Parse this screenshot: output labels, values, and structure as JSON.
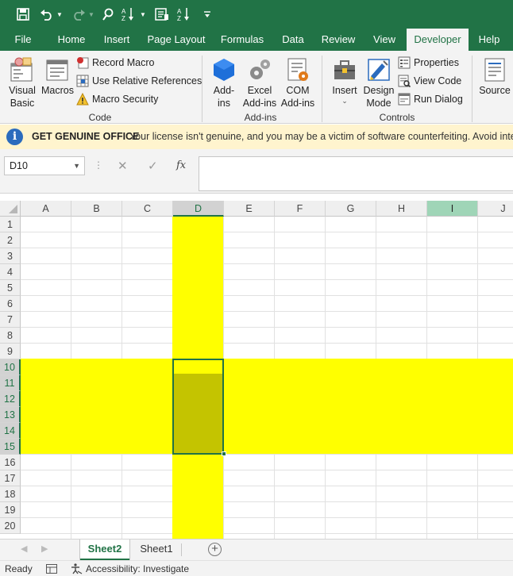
{
  "colors": {
    "excel_green": "#217346",
    "highlight_yellow": "#ffff00",
    "selection_fill": "#c4c400",
    "message_bg": "#fff4ce"
  },
  "quick_access": [
    "save-icon",
    "undo-icon",
    "redo-icon",
    "find-icon",
    "sort-ascending-icon",
    "form-icon",
    "sort-descending-icon",
    "customize-icon"
  ],
  "ribbon_tabs": [
    "File",
    "Home",
    "Insert",
    "Page Layout",
    "Formulas",
    "Data",
    "Review",
    "View",
    "Developer",
    "Help"
  ],
  "active_tab": "Developer",
  "ribbon": {
    "code_group": {
      "label": "Code",
      "visual_basic": [
        "Visual",
        "Basic"
      ],
      "macros": "Macros",
      "record_macro": "Record Macro",
      "relative_refs": "Use Relative References",
      "macro_security": "Macro Security"
    },
    "addins_group": {
      "label": "Add-ins",
      "addins": [
        "Add-",
        "ins"
      ],
      "excel_addins": [
        "Excel",
        "Add-ins"
      ],
      "com_addins": [
        "COM",
        "Add-ins"
      ]
    },
    "controls_group": {
      "label": "Controls",
      "insert": "Insert",
      "design_mode": [
        "Design",
        "Mode"
      ],
      "properties": "Properties",
      "view_code": "View Code",
      "run_dialog": "Run Dialog"
    },
    "xml_group": {
      "source": "Source"
    }
  },
  "message_bar": {
    "title": "GET GENUINE OFFICE",
    "text": "Your license isn't genuine, and you may be a victim of software counterfeiting. Avoid interru"
  },
  "formula_bar": {
    "name_box": "D10",
    "fx": "fx",
    "value": ""
  },
  "columns": [
    "A",
    "B",
    "C",
    "D",
    "E",
    "F",
    "G",
    "H",
    "I",
    "J"
  ],
  "rows": [
    "1",
    "2",
    "3",
    "4",
    "5",
    "6",
    "7",
    "8",
    "9",
    "10",
    "11",
    "12",
    "13",
    "14",
    "15",
    "16",
    "17",
    "18",
    "19",
    "20"
  ],
  "selection": {
    "active_cell": "D10",
    "range": "D10:D15",
    "highlighted_column": "D",
    "highlighted_rows": "10:15",
    "hovered_column": "I"
  },
  "sheets": [
    "Sheet2",
    "Sheet1"
  ],
  "active_sheet": "Sheet2",
  "status": {
    "ready": "Ready",
    "accessibility": "Accessibility: Investigate"
  }
}
